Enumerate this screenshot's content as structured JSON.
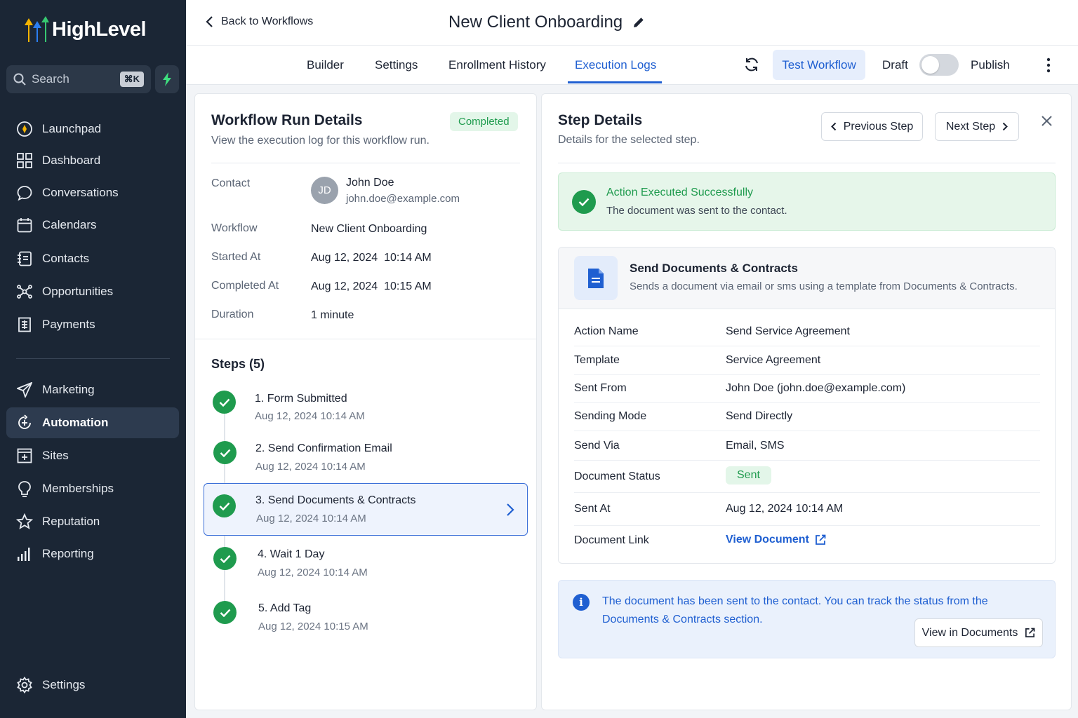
{
  "brand": {
    "name": "HighLevel"
  },
  "sidebar": {
    "search": {
      "label": "Search",
      "shortcut": "⌘K"
    },
    "items": [
      {
        "label": "Launchpad",
        "icon": "launchpad-icon"
      },
      {
        "label": "Dashboard",
        "icon": "dashboard-grid-icon"
      },
      {
        "label": "Conversations",
        "icon": "chat-bubble-icon"
      },
      {
        "label": "Calendars",
        "icon": "calendar-icon"
      },
      {
        "label": "Contacts",
        "icon": "contacts-icon"
      },
      {
        "label": "Opportunities",
        "icon": "opportunities-icon"
      },
      {
        "label": "Payments",
        "icon": "payments-icon"
      },
      {
        "label": "Marketing",
        "icon": "send-icon"
      },
      {
        "label": "Automation",
        "icon": "automation-icon",
        "active": true
      },
      {
        "label": "Sites",
        "icon": "sites-icon"
      },
      {
        "label": "Memberships",
        "icon": "memberships-icon"
      },
      {
        "label": "Reputation",
        "icon": "star-icon"
      },
      {
        "label": "Reporting",
        "icon": "bar-chart-icon"
      }
    ],
    "settings_label": "Settings"
  },
  "header": {
    "back_label": "Back to Workflows",
    "title": "New Client Onboarding"
  },
  "tabs": [
    "Builder",
    "Settings",
    "Enrollment History",
    "Execution Logs"
  ],
  "active_tab": "Execution Logs",
  "toolbar": {
    "test_label": "Test Workflow",
    "draft_label": "Draft",
    "publish_label": "Publish"
  },
  "run": {
    "title": "Workflow Run Details",
    "subtitle": "View the execution log for this workflow run.",
    "status": "Completed",
    "contact_label": "Contact",
    "contact_initials": "JD",
    "contact_name": "John Doe",
    "contact_email": "john.doe@example.com",
    "workflow_label": "Workflow",
    "workflow_value": "New Client Onboarding",
    "started_label": "Started At",
    "started_value": "Aug 12, 2024  10:14 AM",
    "completed_label": "Completed At",
    "completed_value": "Aug 12, 2024  10:15 AM",
    "duration_label": "Duration",
    "duration_value": "1 minute"
  },
  "steps": {
    "title": "Steps (5)",
    "items": [
      {
        "name": "1. Form Submitted",
        "time": "Aug 12, 2024 10:14 AM"
      },
      {
        "name": "2. Send Confirmation Email",
        "time": "Aug 12, 2024 10:14 AM"
      },
      {
        "name": "3. Send Documents & Contracts",
        "time": "Aug 12, 2024 10:14 AM",
        "selected": true
      },
      {
        "name": "4. Wait 1 Day",
        "time": "Aug 12, 2024 10:14 AM"
      },
      {
        "name": "5. Add Tag",
        "time": "Aug 12, 2024 10:15 AM"
      }
    ]
  },
  "step_details": {
    "title": "Step Details",
    "subtitle": "Details for the selected step.",
    "prev_label": "Previous Step",
    "next_label": "Next Step",
    "success_title": "Action Executed Successfully",
    "success_text": "The document was sent to the contact.",
    "action_title": "Send Documents & Contracts",
    "action_desc": "Sends a document via email or sms using a template from Documents & Contracts.",
    "rows": {
      "action_name": {
        "k": "Action Name",
        "v": "Send Service Agreement"
      },
      "template": {
        "k": "Template",
        "v": "Service Agreement"
      },
      "sent_from": {
        "k": "Sent From",
        "v": "John Doe (john.doe@example.com)"
      },
      "sending_mode": {
        "k": "Sending Mode",
        "v": "Send Directly"
      },
      "send_via": {
        "k": "Send Via",
        "v": "Email, SMS"
      },
      "doc_status": {
        "k": "Document Status",
        "v": "Sent"
      },
      "sent_at": {
        "k": "Sent At",
        "v": "Aug 12, 2024 10:14 AM"
      },
      "doc_link": {
        "k": "Document Link",
        "v": "View Document"
      }
    },
    "info_text": "The document has been sent to the contact. You can track the status from the Documents & Contracts section.",
    "info_button": "View in Documents"
  },
  "colors": {
    "accent": "#1f5fd1",
    "success": "#1f9b4e",
    "sidebar_bg": "#1b2635"
  }
}
